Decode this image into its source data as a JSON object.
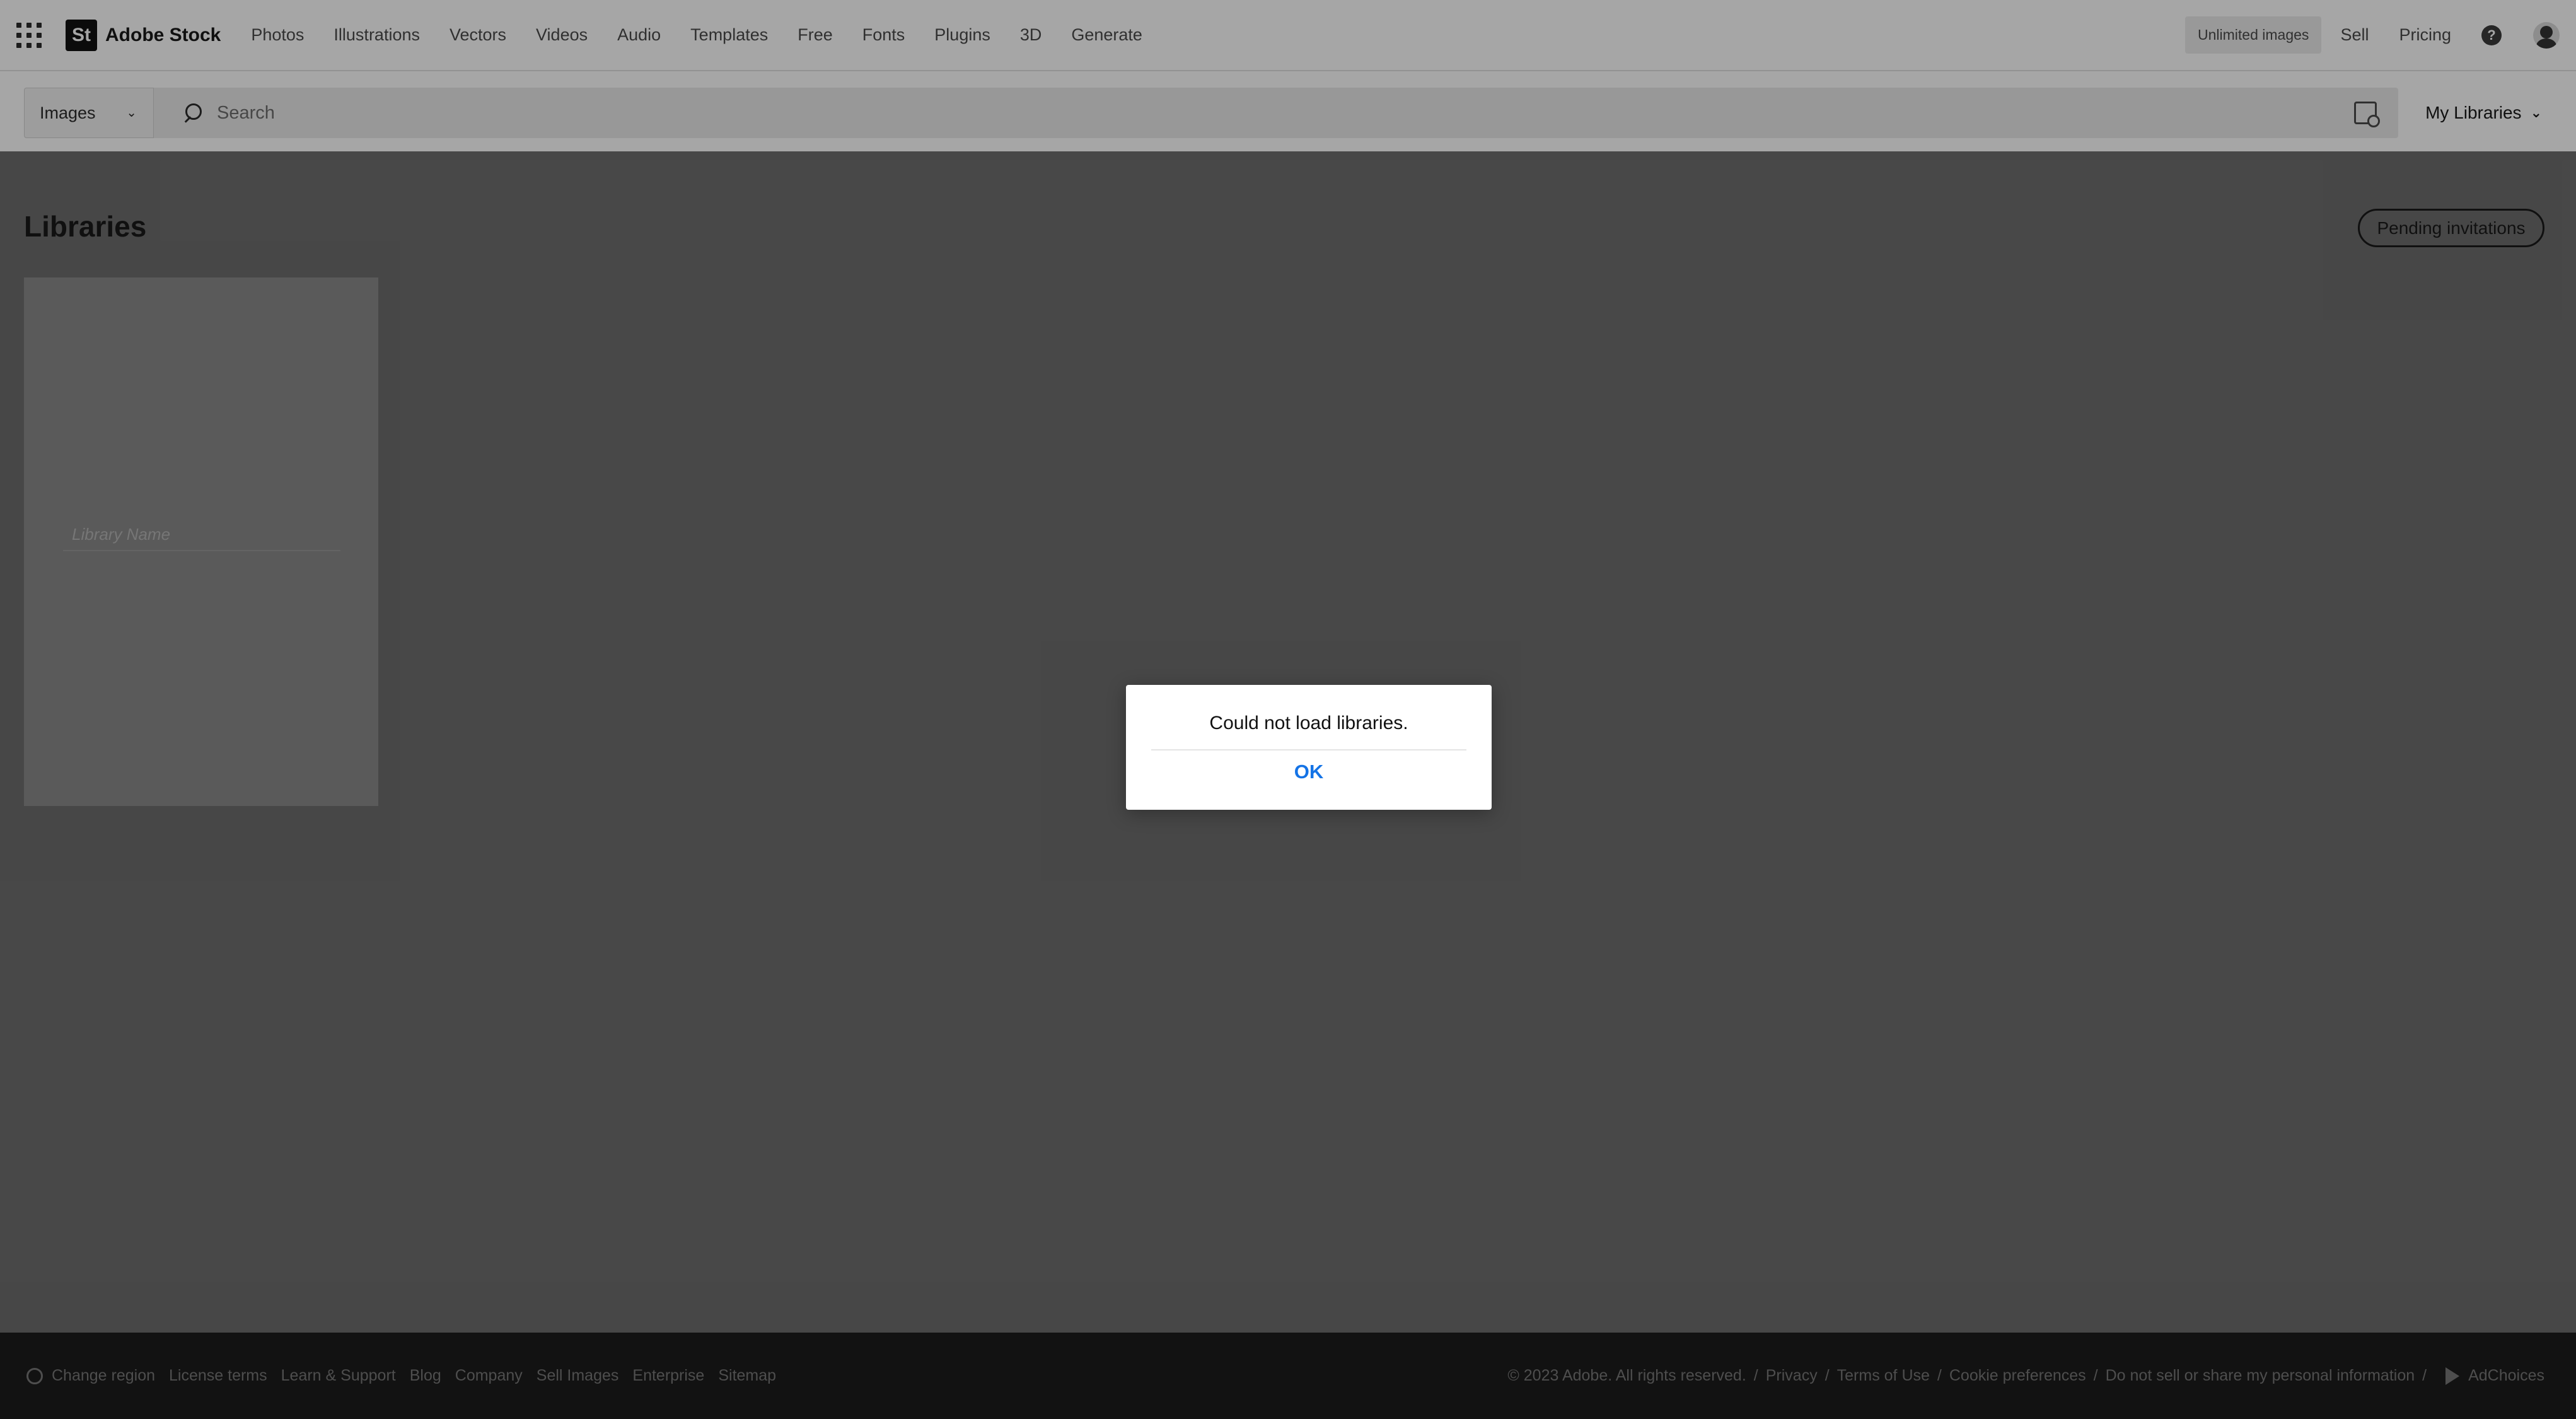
{
  "brand": {
    "mark": "St",
    "name": "Adobe Stock"
  },
  "nav": [
    "Photos",
    "Illustrations",
    "Vectors",
    "Videos",
    "Audio",
    "Templates",
    "Free",
    "Fonts",
    "Plugins",
    "3D",
    "Generate"
  ],
  "top_right": {
    "unlimited": "Unlimited images",
    "sell": "Sell",
    "pricing": "Pricing",
    "help": "?"
  },
  "search": {
    "type_value": "Images",
    "placeholder": "Search",
    "my_libraries": "My Libraries"
  },
  "page": {
    "title": "Libraries",
    "pending_invitations": "Pending invitations",
    "library_name_placeholder": "Library Name"
  },
  "dialog": {
    "message": "Could not load libraries.",
    "ok": "OK"
  },
  "footer": {
    "left": [
      "Change region",
      "License terms",
      "Learn & Support",
      "Blog",
      "Company",
      "Sell Images",
      "Enterprise",
      "Sitemap"
    ],
    "right": [
      "© 2023 Adobe. All rights reserved.",
      "Privacy",
      "Terms of Use",
      "Cookie preferences",
      "Do not sell or share my personal information"
    ],
    "adchoices": "AdChoices"
  },
  "colors": {
    "accent": "#1473e6",
    "overlay": "#4b4b4b",
    "footer": "#121212"
  },
  "icons": [
    "app-grid-icon",
    "search-icon",
    "visual-search-icon",
    "chevron-down-icon",
    "help-icon",
    "globe-icon",
    "adchoices-icon"
  ]
}
